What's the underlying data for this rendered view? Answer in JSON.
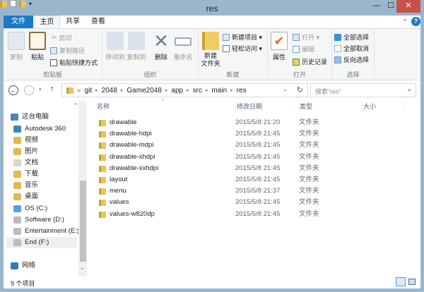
{
  "window": {
    "title": "res",
    "minimize": "—",
    "maximize": "☐",
    "close": "✕"
  },
  "tabs": [
    "文件",
    "主页",
    "共享",
    "查看"
  ],
  "ribbon": {
    "clipboard": {
      "label": "剪贴板",
      "copy": "复制",
      "paste": "粘贴",
      "cut": "剪切",
      "copy_path": "复制路径",
      "paste_shortcut": "粘贴快捷方式"
    },
    "organize": {
      "label": "组织",
      "move_to": "移动到",
      "copy_to": "复制到",
      "delete": "删除",
      "rename": "重命名"
    },
    "new": {
      "label": "新建",
      "new_folder": "新建\n文件夹",
      "new_item": "新建项目 ▾",
      "easy_access": "轻松访问 ▾"
    },
    "open": {
      "label": "打开",
      "properties": "属性",
      "open": "打开 ▾",
      "edit": "编辑",
      "history": "历史记录"
    },
    "select": {
      "label": "选择",
      "select_all": "全部选择",
      "select_none": "全部取消",
      "invert": "反向选择"
    }
  },
  "address": {
    "crumbs": [
      "git",
      "2048",
      "Game2048",
      "app",
      "src",
      "main",
      "res"
    ],
    "search_placeholder": "搜索\"res\""
  },
  "columns": {
    "name": "名称",
    "date": "修改日期",
    "type": "类型",
    "size": "大小"
  },
  "nav": [
    {
      "label": "这台电脑",
      "color": "#4a7fc0"
    },
    {
      "label": "Autodesk 360",
      "color": "#3a86b0"
    },
    {
      "label": "视频",
      "color": "#e2b850"
    },
    {
      "label": "图片",
      "color": "#e2b850"
    },
    {
      "label": "文档",
      "color": "#d8d8d0"
    },
    {
      "label": "下载",
      "color": "#e2b850"
    },
    {
      "label": "音乐",
      "color": "#e2b850"
    },
    {
      "label": "桌面",
      "color": "#e2b850"
    },
    {
      "label": "OS (C:)",
      "color": "#5aa0d8"
    },
    {
      "label": "Software (D:)",
      "color": "#bbbbbb"
    },
    {
      "label": "Entertainment (E:)",
      "color": "#bbbbbb"
    },
    {
      "label": "End (F:)",
      "color": "#bbbbbb"
    },
    {
      "label": "网络",
      "color": "#2e7bc0"
    }
  ],
  "files": [
    {
      "name": "drawable",
      "date": "2015/5/8 21:20",
      "type": "文件夹"
    },
    {
      "name": "drawable-hdpi",
      "date": "2015/5/8 21:45",
      "type": "文件夹"
    },
    {
      "name": "drawable-mdpi",
      "date": "2015/5/8 21:45",
      "type": "文件夹"
    },
    {
      "name": "drawable-xhdpi",
      "date": "2015/5/8 21:45",
      "type": "文件夹"
    },
    {
      "name": "drawable-xxhdpi",
      "date": "2015/5/8 21:45",
      "type": "文件夹"
    },
    {
      "name": "layout",
      "date": "2015/5/8 21:45",
      "type": "文件夹"
    },
    {
      "name": "menu",
      "date": "2015/5/8 21:37",
      "type": "文件夹"
    },
    {
      "name": "values",
      "date": "2015/5/8 21:45",
      "type": "文件夹"
    },
    {
      "name": "values-w820dp",
      "date": "2015/5/8 21:45",
      "type": "文件夹"
    }
  ],
  "status": {
    "count": "9 个项目"
  },
  "colors": {
    "accent": "#1979ca",
    "close": "#c7504b",
    "frame": "#9ab6cd"
  }
}
